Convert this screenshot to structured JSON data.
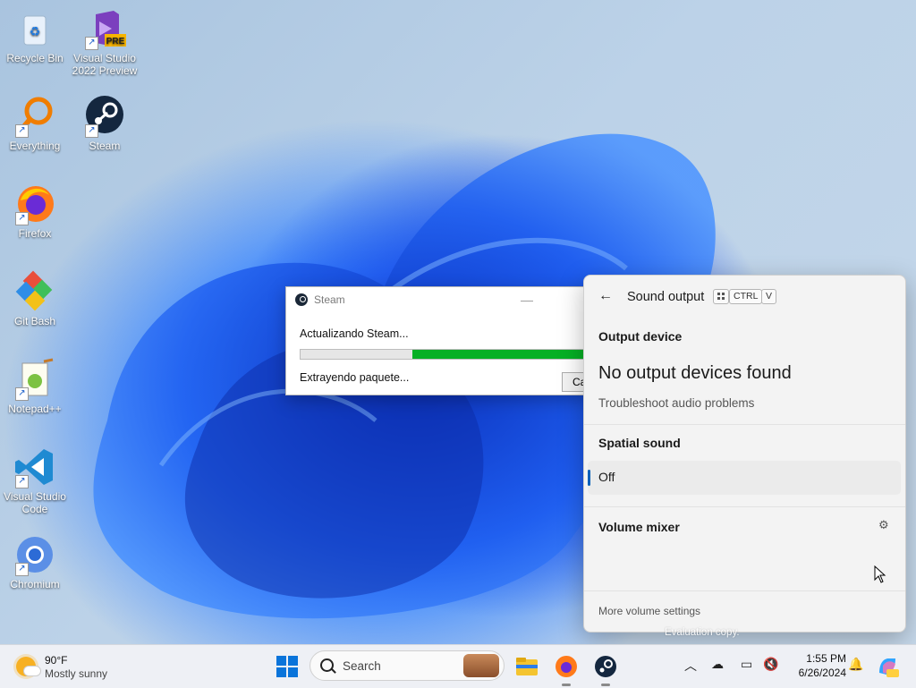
{
  "desktop": {
    "icons": [
      {
        "label": "Recycle Bin"
      },
      {
        "label": "Visual Studio 2022 Preview",
        "badge": "PRE"
      },
      {
        "label": "Everything"
      },
      {
        "label": "Steam"
      },
      {
        "label": "Firefox"
      },
      {
        "label": "Git Bash"
      },
      {
        "label": "Notepad++"
      },
      {
        "label": "Visual Studio Code"
      },
      {
        "label": "Chromium"
      }
    ]
  },
  "steam_window": {
    "title": "Steam",
    "status": "Actualizando Steam...",
    "progress": 0.38,
    "substatus": "Extrayendo paquete...",
    "cancel_label": "Ca"
  },
  "sound_flyout": {
    "title": "Sound output",
    "shortcut_ctrl": "CTRL",
    "shortcut_v": "V",
    "output_device_label": "Output device",
    "no_devices": "No output devices found",
    "troubleshoot": "Troubleshoot audio problems",
    "spatial_label": "Spatial sound",
    "spatial_value": "Off",
    "mixer_label": "Volume mixer",
    "more_settings": "More volume settings"
  },
  "watermark": "Evaluation copy.",
  "taskbar": {
    "weather_temp": "90°F",
    "weather_desc": "Mostly sunny",
    "search_label": "Search",
    "time": "1:55 PM",
    "date": "6/26/2024"
  },
  "colors": {
    "accent": "#005fb8",
    "progress_fill": "#06b025"
  }
}
